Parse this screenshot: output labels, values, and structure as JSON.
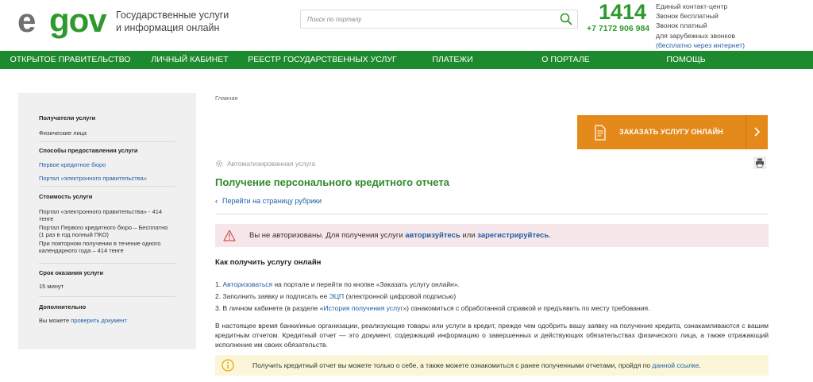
{
  "header": {
    "logo": {
      "e": "e",
      "gov": "gov"
    },
    "tagline": [
      "Государственные услуги",
      "и информация онлайн"
    ],
    "search_placeholder": "Поиск по порталу",
    "contact": {
      "short_number": "1414",
      "phone": "+7 7172 906 984",
      "lines": [
        "Единый контакт-центр",
        "Звонок бесплатный",
        "Звонок платный",
        "для зарубежных звонков"
      ],
      "note": "(бесплатно через интернет)"
    }
  },
  "nav": {
    "items": [
      {
        "label": "ОТКРЫТОЕ ПРАВИТЕЛЬСТВО"
      },
      {
        "label": "ЛИЧНЫЙ КАБИНЕТ"
      },
      {
        "label": "РЕЕСТР ГОСУДАРСТВЕННЫХ УСЛУГ"
      },
      {
        "label": "ПЛАТЕЖИ"
      },
      {
        "label": "О ПОРТАЛЕ"
      },
      {
        "label": "ПОМОЩЬ"
      }
    ]
  },
  "sidebar": {
    "recipients": {
      "title": "Получатели услуги",
      "value": "Физические лица"
    },
    "methods": {
      "title": "Способы предоставления услуги",
      "links": [
        "Первое кредитное бюро",
        "Портал «электронного правительства»"
      ]
    },
    "cost": {
      "title": "Стоимость услуги",
      "lines": [
        [
          "Портал «электронного правительства» - 414",
          "тенге"
        ],
        [
          "Портал Первого кредитного бюро – Бесплатно",
          "(1 раз в год полный ПКО)"
        ],
        [
          "При повторном получении в течение одного",
          "календарного года – 414 тенге"
        ]
      ]
    },
    "term": {
      "title": "Срок оказания услуги",
      "value": "15 минут"
    },
    "extra": {
      "title": "Дополнительно",
      "text": "Вы можете ",
      "link": "проверить документ"
    }
  },
  "main": {
    "breadcrumb": "Главная",
    "order_button": "ЗАКАЗАТЬ УСЛУГУ ОНЛАЙН",
    "automated_label": "Автоматизированная услуга",
    "title": "Получение персонального кредитного отчета",
    "back_link": "Перейти на страницу рубрики",
    "alert": {
      "text_before": "Вы не авторизованы. Для получения услуги ",
      "link1": "авторизуйтесь",
      "mid": " или ",
      "link2": "зарегистрируйтесь",
      "end": "."
    },
    "how_title": "Как получить услугу онлайн",
    "steps": [
      {
        "num": "1. ",
        "link": "Авторизоваться",
        "text": " на портале и перейти по кнопке «Заказать услугу онлайн»."
      },
      {
        "num": "2. ",
        "pre": "Заполнить заявку и подписать ее ",
        "link": "ЭЦП",
        "text": " (электронной цифровой подписью)"
      },
      {
        "num": "3. ",
        "pre": "В личном кабинете (в разделе «",
        "link": "История получения услуг",
        "text": "») ознакомиться с обработанной справкой и предъявить по месту требования."
      }
    ],
    "paragraph": "В настоящее время банки/иные организации, реализующие товары или услуги в кредит, прежде чем одобрить вашу заявку на получение кредита, ознакамливаются с вашим кредитным отчетом. Кредитный отчет — это документ, содержащий информацию о завершенных и действующих обязательствах физического лица, а также отражающий исполнение им своих обязательств.",
    "info": {
      "text": "Получить кредитный отчет вы можете только о себе, а также можете ознакомиться с ранее полученными отчетами, пройдя по ",
      "link": "данной ссылке",
      "end": "."
    }
  },
  "colors": {
    "brand_green": "#1e8a2f",
    "title_green": "#2e8a2e",
    "order_orange": "#e48a1a",
    "link_blue": "#1d5fa6",
    "alert_red_bg": "#f7e6e9",
    "alert_yellow_bg": "#fbf6d8"
  }
}
